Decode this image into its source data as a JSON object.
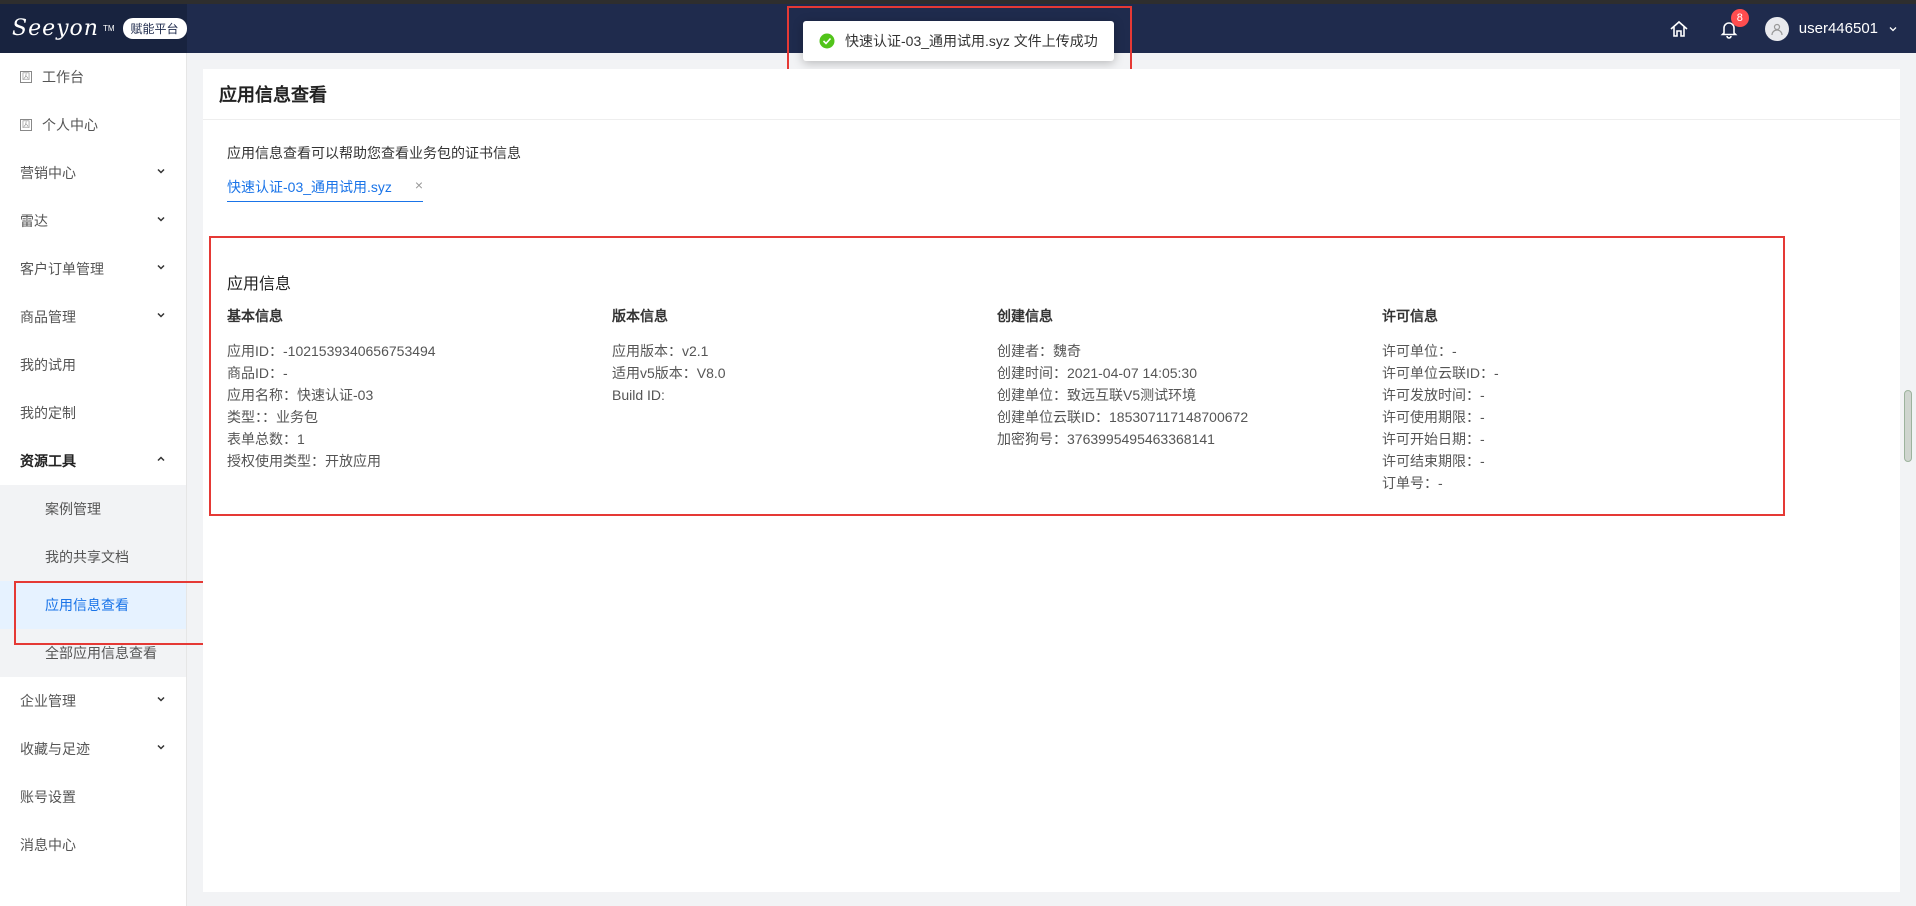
{
  "header": {
    "logo": "Seeyon",
    "logo_tm": "TM",
    "platform_badge": "赋能平台",
    "notif_count": "8",
    "username": "user446501"
  },
  "toast": {
    "message": "快速认证-03_通用试用.syz 文件上传成功"
  },
  "sidebar": {
    "items": [
      {
        "label": "工作台"
      },
      {
        "label": "个人中心"
      },
      {
        "label": "营销中心"
      },
      {
        "label": "雷达"
      },
      {
        "label": "客户订单管理"
      },
      {
        "label": "商品管理"
      },
      {
        "label": "我的试用"
      },
      {
        "label": "我的定制"
      },
      {
        "label": "资源工具"
      },
      {
        "label": "企业管理"
      },
      {
        "label": "收藏与足迹"
      },
      {
        "label": "账号设置"
      },
      {
        "label": "消息中心"
      }
    ],
    "sub_items": [
      {
        "label": "案例管理"
      },
      {
        "label": "我的共享文档"
      },
      {
        "label": "应用信息查看"
      },
      {
        "label": "全部应用信息查看"
      }
    ]
  },
  "main": {
    "title": "应用信息查看",
    "description": "应用信息查看可以帮助您查看业务包的证书信息",
    "file_name": "快速认证-03_通用试用.syz",
    "file_close": "×",
    "info_title": "应用信息",
    "columns": [
      {
        "head": "基本信息",
        "rows": [
          "应用ID：-1021539340656753494",
          "商品ID：-",
          "应用名称：快速认证-03",
          "类型：：业务包",
          "表单总数：1",
          "授权使用类型：开放应用"
        ]
      },
      {
        "head": "版本信息",
        "rows": [
          "应用版本：v2.1",
          "适用v5版本：V8.0",
          "Build ID:"
        ]
      },
      {
        "head": "创建信息",
        "rows": [
          "创建者：魏奇",
          "创建时间：2021-04-07 14:05:30",
          "创建单位：致远互联V5测试环境",
          "创建单位云联ID：185307117148700672",
          "加密狗号：3763995495463368141"
        ]
      },
      {
        "head": "许可信息",
        "rows": [
          "许可单位：-",
          "许可单位云联ID：-",
          "许可发放时间：-",
          "许可使用期限：-",
          "许可开始日期：-",
          "许可结束期限：-",
          "订单号：-"
        ]
      }
    ]
  }
}
